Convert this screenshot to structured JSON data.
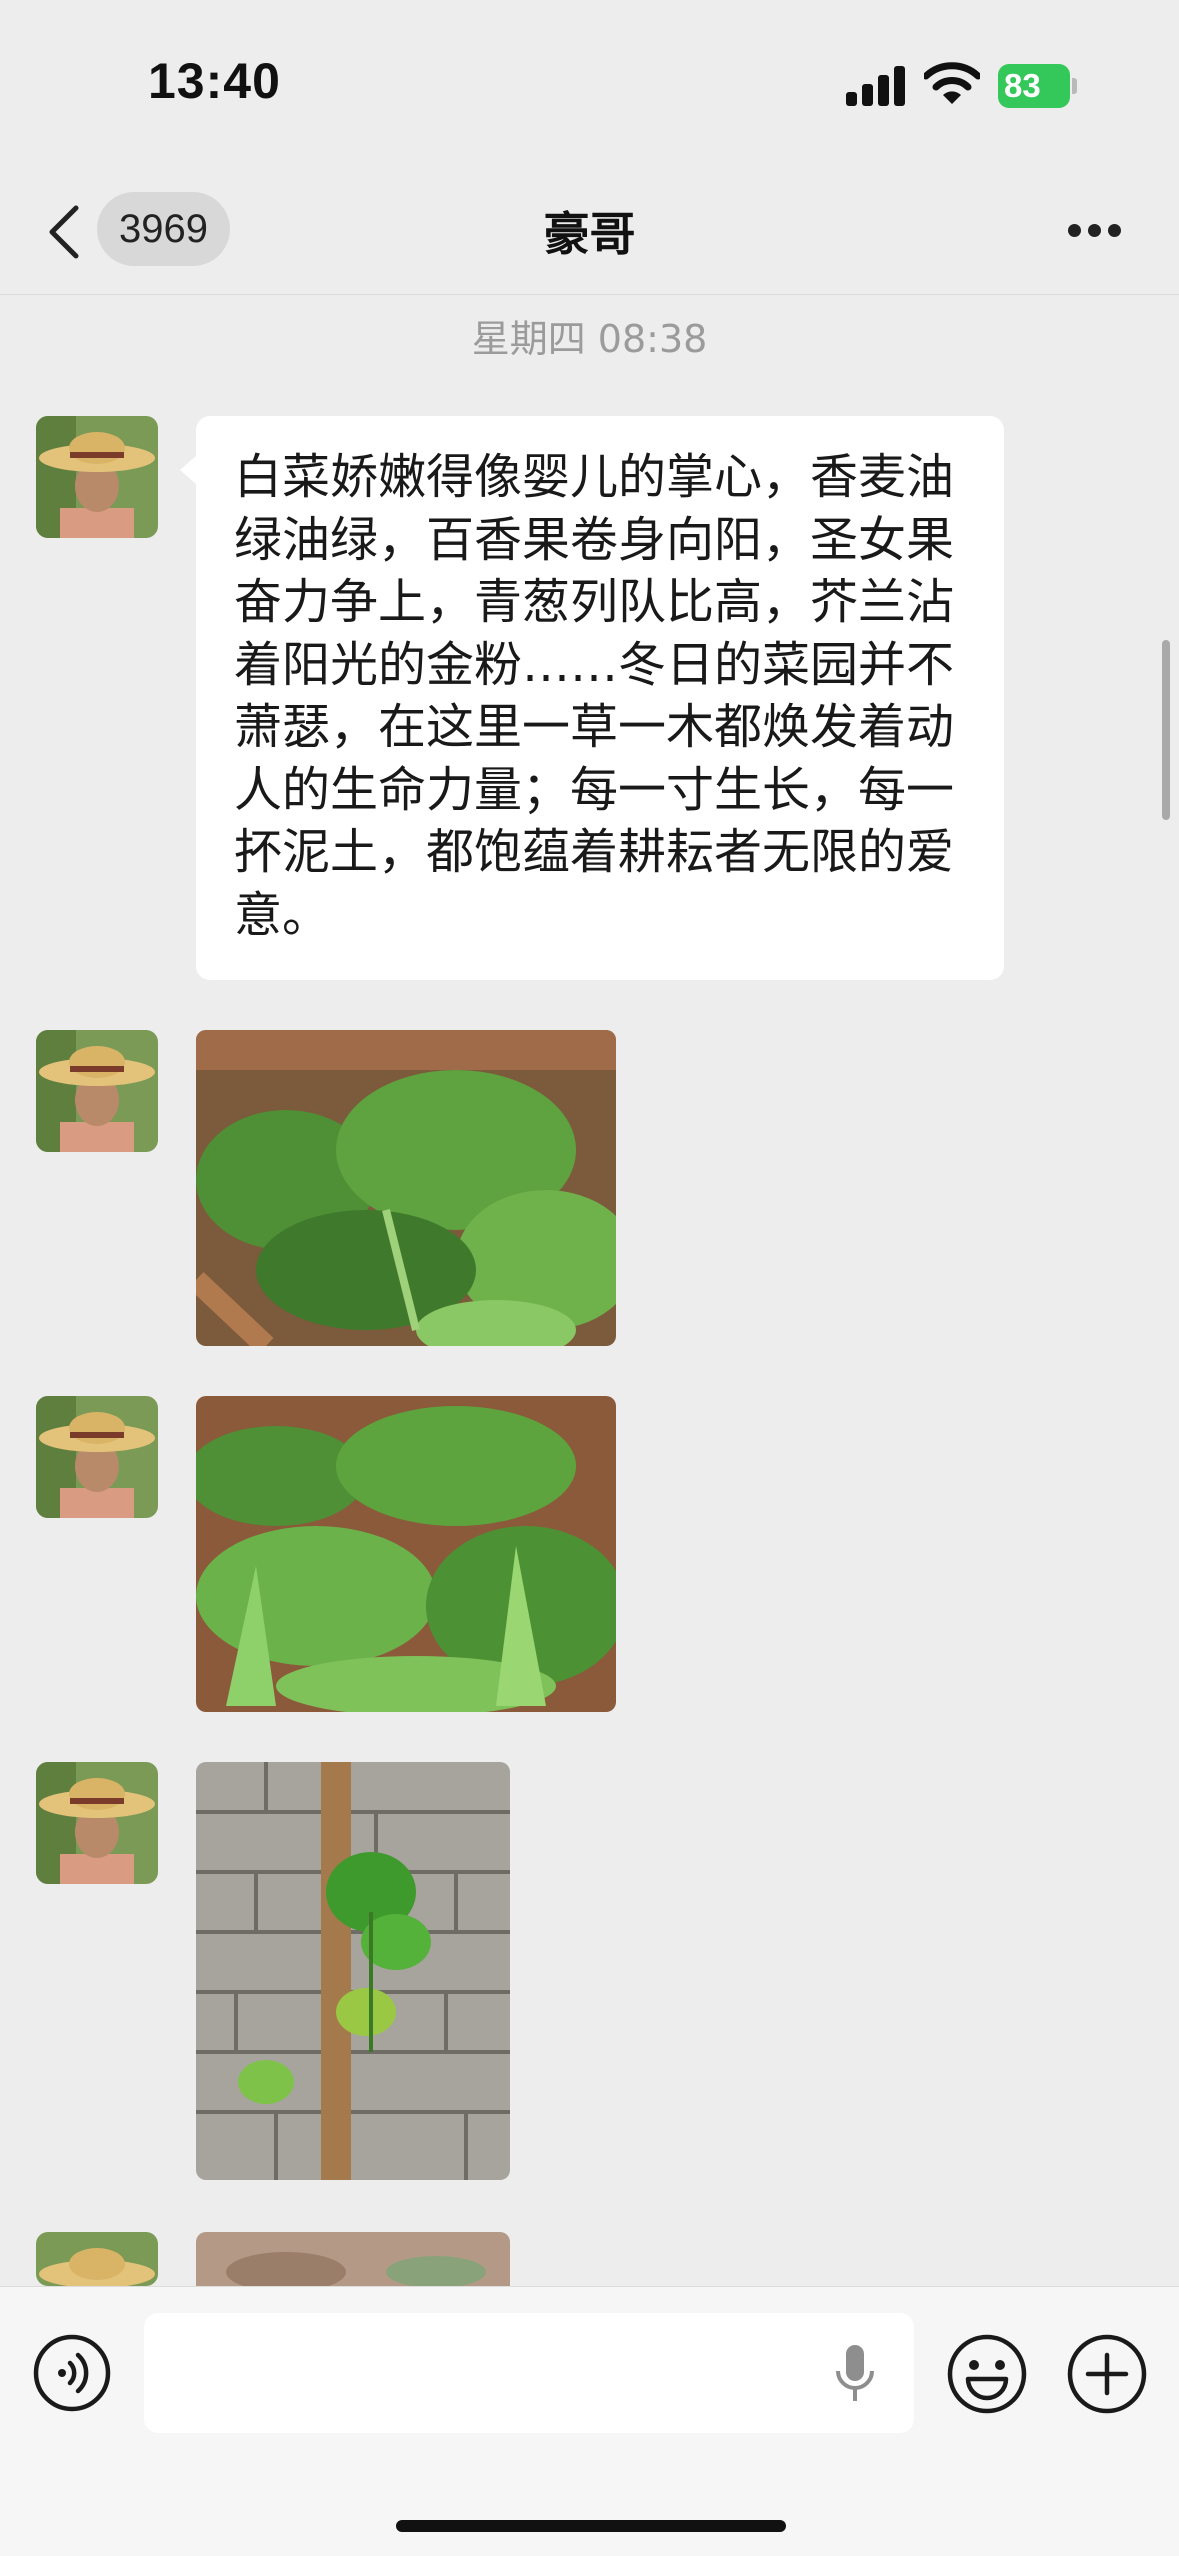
{
  "status_bar": {
    "time": "13:40",
    "battery": "83"
  },
  "nav": {
    "unread_count": "3969",
    "title": "豪哥"
  },
  "chat": {
    "timestamp": "星期四 08:38",
    "message_text": "白菜娇嫩得像婴儿的掌心，香麦油绿油绿，百香果卷身向阳，圣女果奋力争上，青葱列队比高，芥兰沾着阳光的金粉……冬日的菜园并不萧瑟，在这里一草一木都焕发着动人的生命力量；每一寸生长，每一抔泥土，都饱蕴着耕耘者无限的爱意。"
  },
  "colors": {
    "background": "#ededed",
    "bubble": "#ffffff",
    "battery": "#34c759"
  }
}
